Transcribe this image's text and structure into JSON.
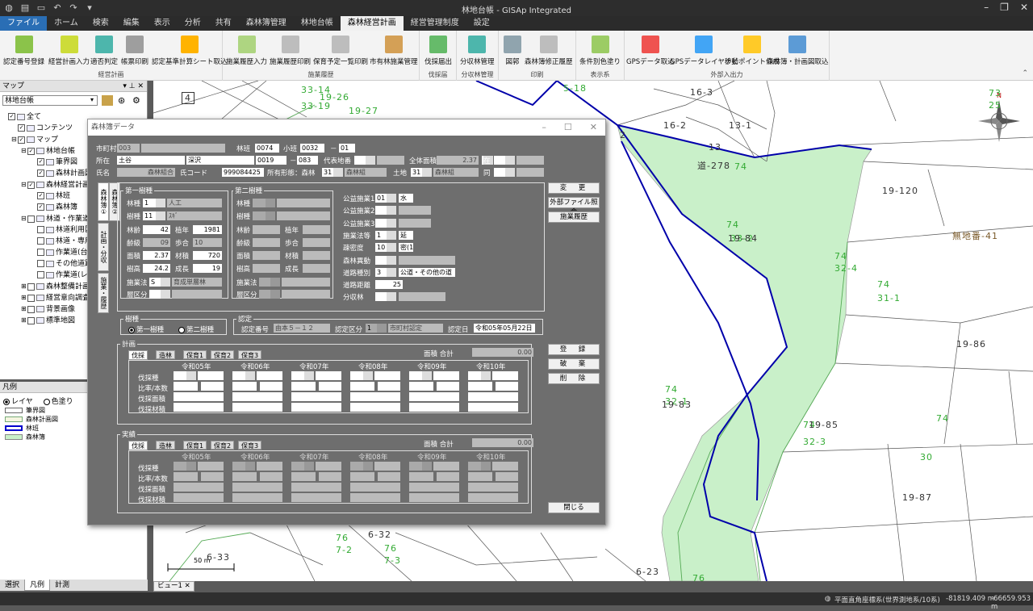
{
  "app": {
    "title": "林地台帳 - GISAp Integrated"
  },
  "menu": [
    "ファイル",
    "ホーム",
    "検索",
    "編集",
    "表示",
    "分析",
    "共有",
    "森林簿管理",
    "林地台帳",
    "森林経営計画",
    "経営管理制度",
    "設定"
  ],
  "ribbon": {
    "groups": [
      {
        "label": "経営計画",
        "buttons": [
          "認定番号登録",
          "経営計画入力",
          "適否判定",
          "帳票印刷",
          "認定基準計算シート取込"
        ]
      },
      {
        "label": "施業履歴",
        "buttons": [
          "施業履歴入力",
          "施業履歴印刷",
          "保育予定一覧印刷",
          "市有林施業管理"
        ]
      },
      {
        "label": "伐採届",
        "buttons": [
          "伐採届出"
        ]
      },
      {
        "label": "分収林管理",
        "buttons": [
          "分収林管理"
        ]
      },
      {
        "label": "印刷",
        "buttons": [
          "図郭",
          "森林簿修正履歴"
        ]
      },
      {
        "label": "表示系",
        "buttons": [
          "条件別色塗り"
        ]
      },
      {
        "label": "外部入出力",
        "buttons": [
          "GPSデータ取込",
          "GPSデータレイヤ移動",
          "ナビポイント作成",
          "森林簿・計画図取込"
        ]
      }
    ]
  },
  "map_panel": {
    "title": "マップ",
    "dropdown": "林地台帳",
    "tree": [
      {
        "label": "全て",
        "indent": 0,
        "checked": true,
        "expander": ""
      },
      {
        "label": "コンテンツ",
        "indent": 1,
        "checked": true,
        "expander": ""
      },
      {
        "label": "マップ",
        "indent": 1,
        "checked": true,
        "expander": "⊟"
      },
      {
        "label": "林地台帳",
        "indent": 2,
        "checked": true,
        "expander": "⊟"
      },
      {
        "label": "筆界図",
        "indent": 3,
        "checked": true,
        "expander": ""
      },
      {
        "label": "森林計画図",
        "indent": 3,
        "checked": true,
        "expander": ""
      },
      {
        "label": "森林経営計画",
        "indent": 2,
        "checked": true,
        "expander": "⊟"
      },
      {
        "label": "林班",
        "indent": 3,
        "checked": true,
        "expander": ""
      },
      {
        "label": "森林簿",
        "indent": 3,
        "checked": true,
        "expander": ""
      },
      {
        "label": "林道・作業道",
        "indent": 2,
        "checked": false,
        "expander": "⊟"
      },
      {
        "label": "林道利用区",
        "indent": 3,
        "checked": false,
        "expander": ""
      },
      {
        "label": "林道・専用道",
        "indent": 3,
        "checked": false,
        "expander": ""
      },
      {
        "label": "作業道(台帳",
        "indent": 3,
        "checked": false,
        "expander": ""
      },
      {
        "label": "その他道路",
        "indent": 3,
        "checked": false,
        "expander": ""
      },
      {
        "label": "作業道(レー",
        "indent": 3,
        "checked": false,
        "expander": ""
      },
      {
        "label": "森林整備計画図",
        "indent": 2,
        "checked": false,
        "expander": "⊞"
      },
      {
        "label": "経営意向調査",
        "indent": 2,
        "checked": false,
        "expander": "⊞"
      },
      {
        "label": "背景画像",
        "indent": 2,
        "checked": false,
        "expander": "⊞"
      },
      {
        "label": "標準地図",
        "indent": 2,
        "checked": false,
        "expander": "⊞"
      }
    ]
  },
  "legend_panel": {
    "title": "凡例",
    "radio1": "レイヤ",
    "radio2": "色塗り",
    "items": [
      {
        "label": "筆界図",
        "color": "#ffffff",
        "border": "#666"
      },
      {
        "label": "森林計画図",
        "color": "#f5f5e0",
        "border": "#7a7"
      },
      {
        "label": "林班",
        "color": "#ffffff",
        "border": "#0000cc"
      },
      {
        "label": "森林簿",
        "color": "#c9f0c9",
        "border": "#888"
      }
    ]
  },
  "bottom_tabs": [
    "選択",
    "凡例",
    "計測"
  ],
  "view_tab": "ビュー1 ✕",
  "status": {
    "crs": "平面直角座標系(世界測地系/10系)",
    "x": "-81819.409 m",
    "y": "-66659.953 m"
  },
  "map": {
    "scale_label": "50 m",
    "labels": [
      {
        "t": "5-18",
        "c": "#3a3"
      },
      {
        "t": "33-14",
        "c": "#3a3"
      },
      {
        "t": "19-26",
        "c": "#3a3"
      },
      {
        "t": "33-19",
        "c": "#3a3"
      },
      {
        "t": "19-27",
        "c": "#3a3"
      },
      {
        "t": "16-3",
        "c": "#333"
      },
      {
        "t": "16-2",
        "c": "#333"
      },
      {
        "t": "13-1",
        "c": "#333"
      },
      {
        "t": "13",
        "c": "#333"
      },
      {
        "t": "2",
        "c": "#333"
      },
      {
        "t": "73",
        "c": "#3a3"
      },
      {
        "t": "25",
        "c": "#3a3"
      },
      {
        "t": "道-278",
        "c": "#333"
      },
      {
        "t": "74",
        "c": "#3a3"
      },
      {
        "t": "19-120",
        "c": "#333"
      },
      {
        "t": "74",
        "c": "#3a3"
      },
      {
        "t": "33-2",
        "c": "#3a3"
      },
      {
        "t": "19-84",
        "c": "#333"
      },
      {
        "t": "無地番-41",
        "c": "#7a5a2a"
      },
      {
        "t": "74",
        "c": "#3a3"
      },
      {
        "t": "32-4",
        "c": "#3a3"
      },
      {
        "t": "74",
        "c": "#3a3"
      },
      {
        "t": "31-1",
        "c": "#3a3"
      },
      {
        "t": "19-86",
        "c": "#333"
      },
      {
        "t": "74",
        "c": "#3a3"
      },
      {
        "t": "32-1",
        "c": "#3a3"
      },
      {
        "t": "19-83",
        "c": "#333"
      },
      {
        "t": "74",
        "c": "#3a3"
      },
      {
        "t": "32-3",
        "c": "#3a3"
      },
      {
        "t": "19-85",
        "c": "#333"
      },
      {
        "t": "74",
        "c": "#3a3"
      },
      {
        "t": "30",
        "c": "#3a3"
      },
      {
        "t": "19-87",
        "c": "#333"
      },
      {
        "t": "76",
        "c": "#3a3"
      },
      {
        "t": "7-2",
        "c": "#3a3"
      },
      {
        "t": "6-32",
        "c": "#333"
      },
      {
        "t": "76",
        "c": "#3a3"
      },
      {
        "t": "7-3",
        "c": "#3a3"
      },
      {
        "t": "6-33",
        "c": "#333"
      },
      {
        "t": "6-23",
        "c": "#333"
      },
      {
        "t": "76",
        "c": "#3a3"
      },
      {
        "t": "4",
        "c": "#333"
      }
    ]
  },
  "dialog": {
    "title": "森林簿データ",
    "row1": {
      "city_lbl": "市町村",
      "city_code": "003",
      "rinpan_lbl": "林班",
      "rinpan": "0074",
      "shohan_lbl": "小班",
      "shohan": "0032",
      "dash": "－",
      "edaban": "01"
    },
    "row2": {
      "lbl": "所在",
      "v1": "土谷",
      "v2": "深沢",
      "v3": "0019",
      "dash": "－",
      "v4": "083",
      "daihyo_lbl": "代表地番",
      "total_lbl": "全体面積",
      "total": "2.37",
      "zai_lbl": "在"
    },
    "row3": {
      "lbl": "氏名",
      "name": "森林組合",
      "code_lbl": "氏コード",
      "code": "999084425",
      "owner_lbl": "所有形態：森林",
      "owner_code": "31",
      "owner_val": "森林組",
      "land_lbl": "土地",
      "land_code": "31",
      "land_val": "森林組",
      "dou_lbl": "同"
    },
    "vtabs": [
      "森林簿①",
      "森林簿②",
      "計画・分収",
      "施業・履歴"
    ],
    "first": {
      "title": "第一樹種",
      "rinshu_lbl": "林種",
      "rinshu_code": "1",
      "rinshu": "人工",
      "jushu_lbl": "樹種",
      "jushu_code": "11",
      "jushu": "ｽｷﾞ",
      "rinrei_lbl": "林齢",
      "rinrei": "42",
      "kinen_lbl": "植年",
      "kinen": "1981",
      "reikyu_lbl": "齢級",
      "reikyu": "09",
      "buai_lbl": "歩合",
      "buai": "10",
      "menseki_lbl": "面積",
      "menseki": "2.37",
      "zaiseki_lbl": "材積",
      "zaiseki": "720",
      "jukou_lbl": "樹高",
      "jukou": "24.2",
      "seichou_lbl": "成長",
      "seichou": "19",
      "sekou_lbl": "施業法",
      "sekou_code": "S",
      "sekou": "育成単層林",
      "soku_lbl": "層区分"
    },
    "second": {
      "title": "第二樹種",
      "l1": "林種",
      "l2": "樹種",
      "l3": "林齢",
      "l4": "植年",
      "l5": "齢級",
      "l6": "歩合",
      "l7": "面積",
      "l8": "材積",
      "l9": "樹高",
      "l10": "成長",
      "l11": "施業法",
      "l12": "層区分"
    },
    "koueki": {
      "k1_lbl": "公益施業1",
      "k1_code": "01",
      "k1": "水",
      "k2_lbl": "公益施業2",
      "k3_lbl": "公益施業3",
      "sekou_lbl": "施業法等",
      "sekou_code": "1",
      "sekou": "延",
      "sokei_lbl": "疎密度",
      "sokei_code": "10",
      "sokei": "密(10)",
      "shinrin_lbl": "森林異動",
      "douro_lbl": "道路種別",
      "douro_code": "3",
      "douro": "公道・その他の道",
      "kyori_lbl": "道路距離",
      "kyori": "25",
      "bunshu_lbl": "分収林"
    },
    "buttons_right": [
      "変　更",
      "外部ファイル照会",
      "施業履歴"
    ],
    "jushu_box": {
      "title": "樹種",
      "r1": "第一樹種",
      "r2": "第二樹種"
    },
    "nintei": {
      "title": "認定",
      "bango_lbl": "認定番号",
      "bango": "由本５－１２",
      "kubun_lbl": "認定区分",
      "kubun_code": "1",
      "kubun": "市町村認定",
      "date_lbl": "認定日",
      "date": "令和05年05月22日"
    },
    "plan": {
      "title": "計画",
      "total_lbl": "面積 合計",
      "total": "0.00",
      "tabs": [
        "伐採",
        "造林",
        "保育1",
        "保育2",
        "保育3"
      ],
      "years": [
        "令和05年",
        "令和06年",
        "令和07年",
        "令和08年",
        "令和09年",
        "令和10年"
      ],
      "rows": [
        "伐採種",
        "比率/本数",
        "伐採面積",
        "伐採材積"
      ]
    },
    "actual": {
      "title": "実績",
      "total_lbl": "面積 合計",
      "total": "0.00",
      "tabs": [
        "伐採",
        "造林",
        "保育1",
        "保育2",
        "保育3"
      ],
      "years": [
        "令和05年",
        "令和06年",
        "令和07年",
        "令和08年",
        "令和09年",
        "令和10年"
      ],
      "rows": [
        "伐採種",
        "比率/本数",
        "伐採面積",
        "伐採材積"
      ]
    },
    "buttons_mid": [
      "登　録",
      "破　棄",
      "削　除"
    ],
    "close_btn": "閉じる"
  }
}
